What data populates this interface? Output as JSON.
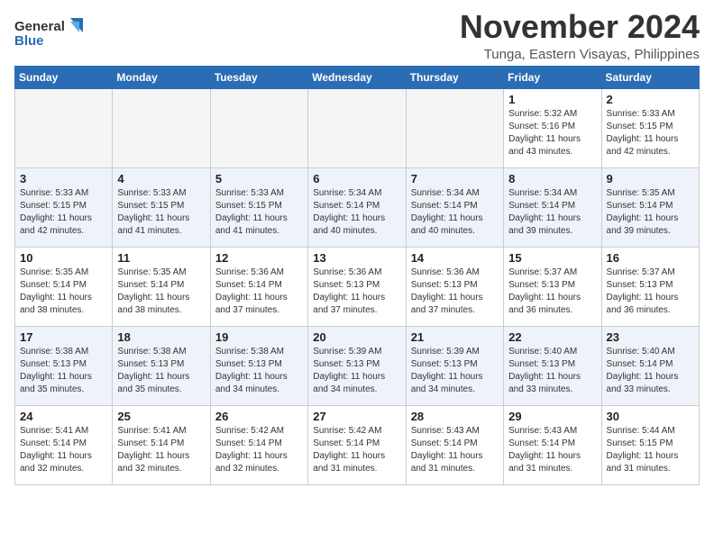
{
  "header": {
    "logo_line1": "General",
    "logo_line2": "Blue",
    "month_title": "November 2024",
    "location": "Tunga, Eastern Visayas, Philippines"
  },
  "weekdays": [
    "Sunday",
    "Monday",
    "Tuesday",
    "Wednesday",
    "Thursday",
    "Friday",
    "Saturday"
  ],
  "weeks": [
    [
      {
        "day": "",
        "info": ""
      },
      {
        "day": "",
        "info": ""
      },
      {
        "day": "",
        "info": ""
      },
      {
        "day": "",
        "info": ""
      },
      {
        "day": "",
        "info": ""
      },
      {
        "day": "1",
        "info": "Sunrise: 5:32 AM\nSunset: 5:16 PM\nDaylight: 11 hours\nand 43 minutes."
      },
      {
        "day": "2",
        "info": "Sunrise: 5:33 AM\nSunset: 5:15 PM\nDaylight: 11 hours\nand 42 minutes."
      }
    ],
    [
      {
        "day": "3",
        "info": "Sunrise: 5:33 AM\nSunset: 5:15 PM\nDaylight: 11 hours\nand 42 minutes."
      },
      {
        "day": "4",
        "info": "Sunrise: 5:33 AM\nSunset: 5:15 PM\nDaylight: 11 hours\nand 41 minutes."
      },
      {
        "day": "5",
        "info": "Sunrise: 5:33 AM\nSunset: 5:15 PM\nDaylight: 11 hours\nand 41 minutes."
      },
      {
        "day": "6",
        "info": "Sunrise: 5:34 AM\nSunset: 5:14 PM\nDaylight: 11 hours\nand 40 minutes."
      },
      {
        "day": "7",
        "info": "Sunrise: 5:34 AM\nSunset: 5:14 PM\nDaylight: 11 hours\nand 40 minutes."
      },
      {
        "day": "8",
        "info": "Sunrise: 5:34 AM\nSunset: 5:14 PM\nDaylight: 11 hours\nand 39 minutes."
      },
      {
        "day": "9",
        "info": "Sunrise: 5:35 AM\nSunset: 5:14 PM\nDaylight: 11 hours\nand 39 minutes."
      }
    ],
    [
      {
        "day": "10",
        "info": "Sunrise: 5:35 AM\nSunset: 5:14 PM\nDaylight: 11 hours\nand 38 minutes."
      },
      {
        "day": "11",
        "info": "Sunrise: 5:35 AM\nSunset: 5:14 PM\nDaylight: 11 hours\nand 38 minutes."
      },
      {
        "day": "12",
        "info": "Sunrise: 5:36 AM\nSunset: 5:14 PM\nDaylight: 11 hours\nand 37 minutes."
      },
      {
        "day": "13",
        "info": "Sunrise: 5:36 AM\nSunset: 5:13 PM\nDaylight: 11 hours\nand 37 minutes."
      },
      {
        "day": "14",
        "info": "Sunrise: 5:36 AM\nSunset: 5:13 PM\nDaylight: 11 hours\nand 37 minutes."
      },
      {
        "day": "15",
        "info": "Sunrise: 5:37 AM\nSunset: 5:13 PM\nDaylight: 11 hours\nand 36 minutes."
      },
      {
        "day": "16",
        "info": "Sunrise: 5:37 AM\nSunset: 5:13 PM\nDaylight: 11 hours\nand 36 minutes."
      }
    ],
    [
      {
        "day": "17",
        "info": "Sunrise: 5:38 AM\nSunset: 5:13 PM\nDaylight: 11 hours\nand 35 minutes."
      },
      {
        "day": "18",
        "info": "Sunrise: 5:38 AM\nSunset: 5:13 PM\nDaylight: 11 hours\nand 35 minutes."
      },
      {
        "day": "19",
        "info": "Sunrise: 5:38 AM\nSunset: 5:13 PM\nDaylight: 11 hours\nand 34 minutes."
      },
      {
        "day": "20",
        "info": "Sunrise: 5:39 AM\nSunset: 5:13 PM\nDaylight: 11 hours\nand 34 minutes."
      },
      {
        "day": "21",
        "info": "Sunrise: 5:39 AM\nSunset: 5:13 PM\nDaylight: 11 hours\nand 34 minutes."
      },
      {
        "day": "22",
        "info": "Sunrise: 5:40 AM\nSunset: 5:13 PM\nDaylight: 11 hours\nand 33 minutes."
      },
      {
        "day": "23",
        "info": "Sunrise: 5:40 AM\nSunset: 5:14 PM\nDaylight: 11 hours\nand 33 minutes."
      }
    ],
    [
      {
        "day": "24",
        "info": "Sunrise: 5:41 AM\nSunset: 5:14 PM\nDaylight: 11 hours\nand 32 minutes."
      },
      {
        "day": "25",
        "info": "Sunrise: 5:41 AM\nSunset: 5:14 PM\nDaylight: 11 hours\nand 32 minutes."
      },
      {
        "day": "26",
        "info": "Sunrise: 5:42 AM\nSunset: 5:14 PM\nDaylight: 11 hours\nand 32 minutes."
      },
      {
        "day": "27",
        "info": "Sunrise: 5:42 AM\nSunset: 5:14 PM\nDaylight: 11 hours\nand 31 minutes."
      },
      {
        "day": "28",
        "info": "Sunrise: 5:43 AM\nSunset: 5:14 PM\nDaylight: 11 hours\nand 31 minutes."
      },
      {
        "day": "29",
        "info": "Sunrise: 5:43 AM\nSunset: 5:14 PM\nDaylight: 11 hours\nand 31 minutes."
      },
      {
        "day": "30",
        "info": "Sunrise: 5:44 AM\nSunset: 5:15 PM\nDaylight: 11 hours\nand 31 minutes."
      }
    ]
  ]
}
